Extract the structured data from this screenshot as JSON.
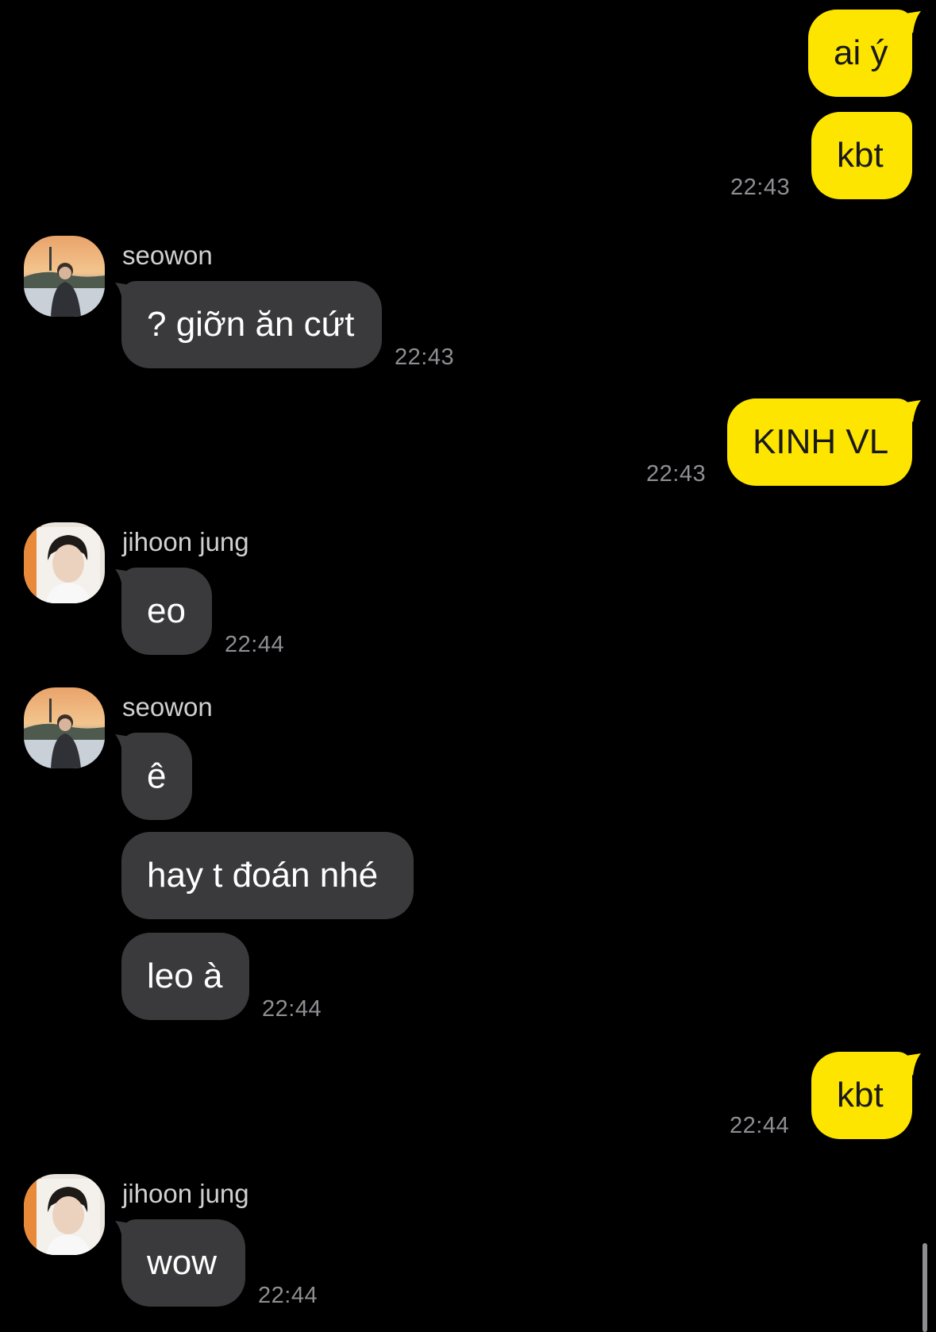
{
  "messages": [
    {
      "side": "out",
      "text": "ai ý"
    },
    {
      "side": "out",
      "text": "kbt",
      "time": "22:43"
    },
    {
      "side": "in",
      "sender": "seowon",
      "avatar": "seowon-avatar",
      "text": "? giỡn ăn cứt",
      "time": "22:43"
    },
    {
      "side": "out",
      "text": "KINH VL",
      "time": "22:43"
    },
    {
      "side": "in",
      "sender": "jihoon jung",
      "avatar": "jihoon-avatar",
      "text": "eo",
      "time": "22:44"
    },
    {
      "side": "in",
      "sender": "seowon",
      "avatar": "seowon-avatar",
      "text": "ê"
    },
    {
      "side": "in",
      "text": "hay t đoán nhé"
    },
    {
      "side": "in",
      "text": "leo à",
      "time": "22:44"
    },
    {
      "side": "out",
      "text": "kbt",
      "time": "22:44"
    },
    {
      "side": "in",
      "sender": "jihoon jung",
      "avatar": "jihoon-avatar",
      "text": "wow",
      "time": "22:44"
    }
  ],
  "colors": {
    "background": "#000000",
    "outgoing_bubble": "#FEE500",
    "incoming_bubble": "#3A3A3C",
    "timestamp": "#8E8E93"
  }
}
